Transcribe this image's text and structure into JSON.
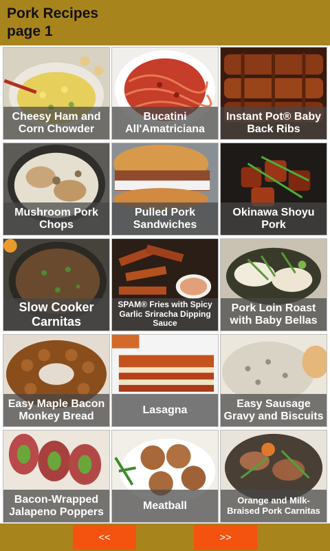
{
  "header": {
    "title_line1": "Pork Recipes",
    "title_line2": "page 1"
  },
  "recipes": [
    {
      "name": "Cheesy Ham and Corn Chowder"
    },
    {
      "name": "Bucatini All'Amatriciana"
    },
    {
      "name": "Instant Pot® Baby Back Ribs"
    },
    {
      "name": "Mushroom Pork Chops"
    },
    {
      "name": "Pulled Pork Sandwiches"
    },
    {
      "name": "Okinawa Shoyu Pork"
    },
    {
      "name": "Slow Cooker Carnitas"
    },
    {
      "name": "SPAM® Fries with Spicy Garlic Sriracha Dipping Sauce"
    },
    {
      "name": "Pork Loin Roast with Baby Bellas"
    },
    {
      "name": "Easy Maple Bacon Monkey Bread"
    },
    {
      "name": "Lasagna"
    },
    {
      "name": "Easy Sausage Gravy and Biscuits"
    },
    {
      "name": "Bacon-Wrapped Jalapeno Poppers"
    },
    {
      "name": "Meatball"
    },
    {
      "name": "Orange and Milk-Braised Pork Carnitas"
    }
  ],
  "nav": {
    "prev_label": "<<",
    "next_label": ">>"
  },
  "colors": {
    "bar": "#a8841c",
    "button": "#f3520f",
    "caption_bg": "#464646"
  }
}
